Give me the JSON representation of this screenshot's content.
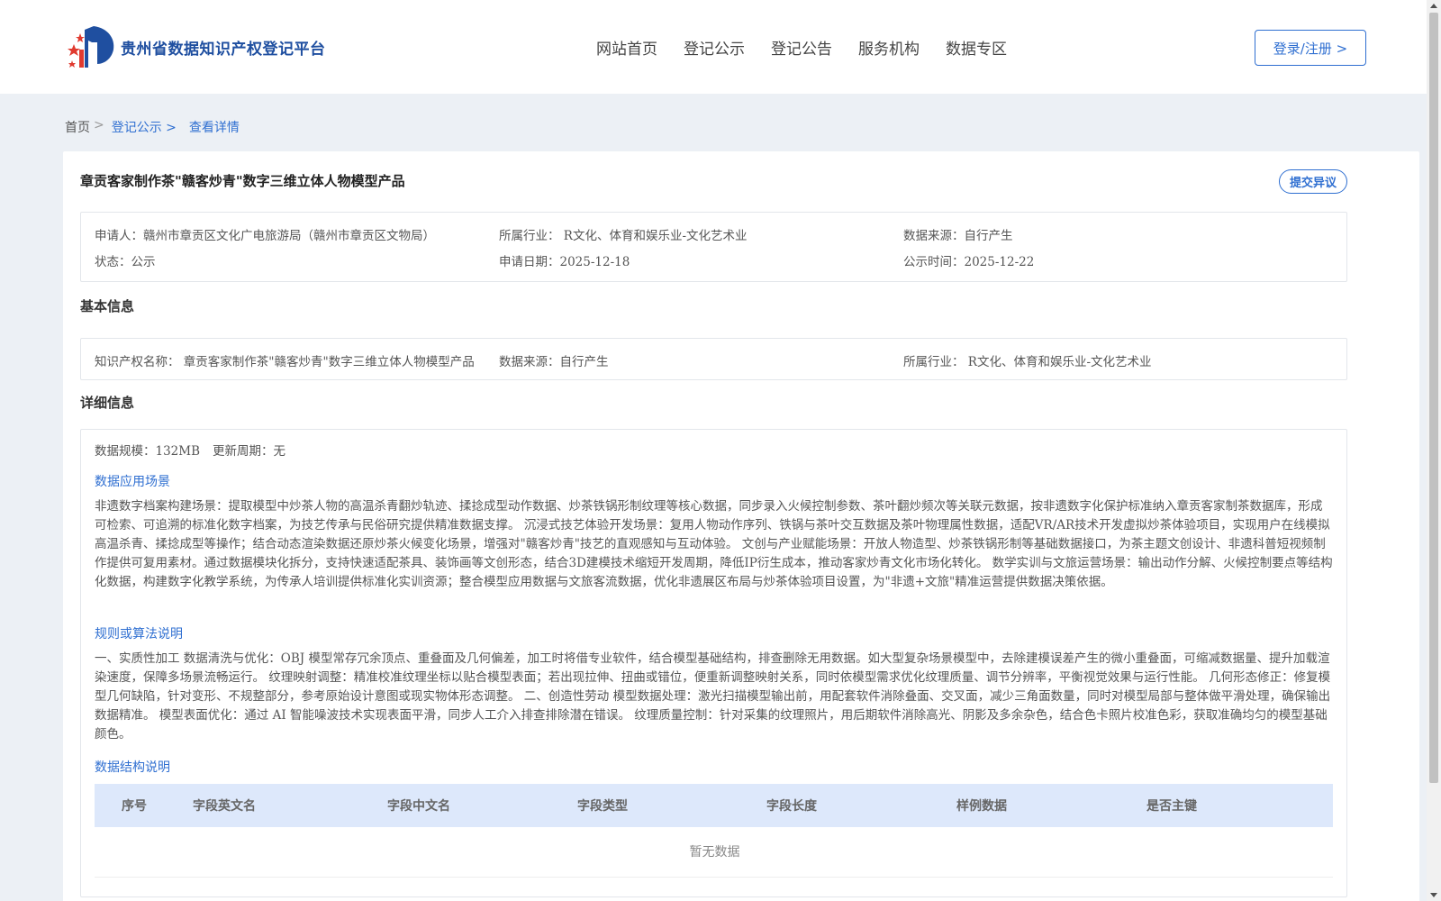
{
  "header": {
    "site_name": "贵州省数据知识产权登记平台",
    "nav": [
      "网站首页",
      "登记公示",
      "登记公告",
      "服务机构",
      "数据专区"
    ],
    "login_label": "登录/注册 >"
  },
  "breadcrumb": {
    "home": "首页",
    "sep": ">",
    "level2": "登记公示 >",
    "current": "查看详情"
  },
  "detail": {
    "title": "章贡客家制作茶\"赣客炒青\"数字三维立体人物模型产品",
    "objection_label": "提交异议",
    "applicant": "申请人：赣州市章贡区文化广电旅游局（赣州市章贡区文物局）",
    "industry": "所属行业： R文化、体育和娱乐业-文化艺术业",
    "source": "数据来源：自行产生",
    "status": "状态：公示",
    "apply_date": "申请日期：2025-12-18",
    "publish_date": "公示时间：2025-12-22"
  },
  "basic": {
    "section_title": "基本信息",
    "ip_name": "知识产权名称： 章贡客家制作茶\"赣客炒青\"数字三维立体人物模型产品",
    "source": "数据来源：自行产生",
    "industry": "所属行业： R文化、体育和娱乐业-文化艺术业"
  },
  "details": {
    "section_title": "详细信息",
    "scale": "数据规模：132MB",
    "update_cycle": "更新周期：无",
    "scenario_title": "数据应用场景",
    "scenario_text": "非遗数字档案构建场景：提取模型中炒茶人物的高温杀青翻炒轨迹、揉捻成型动作数据、炒茶铁锅形制纹理等核心数据，同步录入火候控制参数、茶叶翻炒频次等关联元数据，按非遗数字化保护标准纳入章贡客家制茶数据库，形成可检索、可追溯的标准化数字档案，为技艺传承与民俗研究提供精准数据支撑。 沉浸式技艺体验开发场景：复用人物动作序列、铁锅与茶叶交互数据及茶叶物理属性数据，适配VR/AR技术开发虚拟炒茶体验项目，实现用户在线模拟高温杀青、揉捻成型等操作；结合动态渲染数据还原炒茶火候变化场景，增强对\"赣客炒青\"技艺的直观感知与互动体验。 文创与产业赋能场景：开放人物造型、炒茶铁锅形制等基础数据接口，为茶主题文创设计、非遗科普短视频制作提供可复用素材。通过数据模块化拆分，支持快速适配茶具、装饰画等文创形态，结合3D建模技术缩短开发周期，降低IP衍生成本，推动客家炒青文化市场化转化。 数学实训与文旅运营场景：输出动作分解、火候控制要点等结构化数据，构建数字化教学系统，为传承人培训提供标准化实训资源；整合模型应用数据与文旅客流数据，优化非遗展区布局与炒茶体验项目设置，为\"非遗+文旅\"精准运营提供数据决策依据。",
    "rules_title": "规则或算法说明",
    "rules_text": "一、实质性加工 数据清洗与优化：OBJ 模型常存冗余顶点、重叠面及几何偏差，加工时将借专业软件，结合模型基础结构，排查删除无用数据。如大型复杂场景模型中，去除建模误差产生的微小重叠面，可缩减数据量、提升加载渲染速度，保障多场景流畅运行。 纹理映射调整：精准校准纹理坐标以贴合模型表面；若出现拉伸、扭曲或错位，便重新调整映射关系，同时依模型需求优化纹理质量、调节分辨率，平衡视觉效果与运行性能。 几何形态修正：修复模型几何缺陷，针对变形、不规整部分，参考原始设计意图或现实物体形态调整。 二、创造性劳动 模型数据处理：激光扫描模型输出前，用配套软件消除叠面、交叉面，减少三角面数量，同时对模型局部与整体做平滑处理，确保输出数据精准。 模型表面优化：通过 AI 智能噪波技术实现表面平滑，同步人工介入排查排除潜在错误。 纹理质量控制：针对采集的纹理照片，用后期软件消除高光、阴影及多余杂色，结合色卡照片校准色彩，获取准确均匀的模型基础颜色。",
    "structure_title": "数据结构说明",
    "table_headers": [
      "序号",
      "字段英文名",
      "字段中文名",
      "字段类型",
      "字段长度",
      "样例数据",
      "是否主键"
    ],
    "empty_text": "暂无数据"
  },
  "colors": {
    "brand_blue": "#1f4fa0",
    "link_blue": "#2f6fd1",
    "table_header_bg": "#dde8fb",
    "page_bg": "#ecf0f5"
  }
}
